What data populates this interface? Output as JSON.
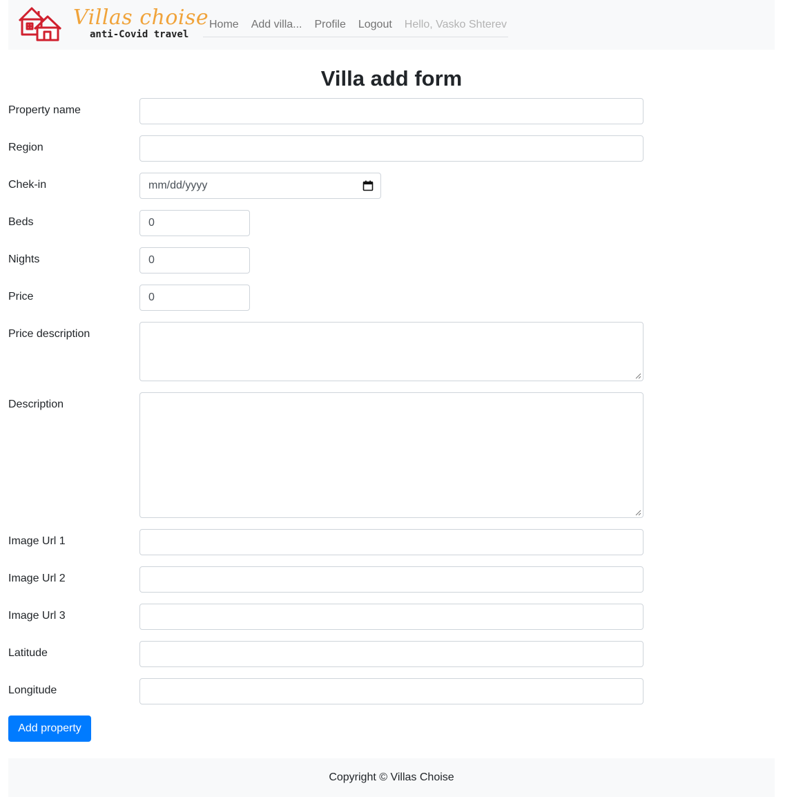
{
  "brand": {
    "name": "Villas choise",
    "tagline": "anti-Covid travel",
    "logo_icon": "houses-icon",
    "colors": {
      "script": "#f0a33a",
      "houses": "#d0202e"
    }
  },
  "nav": {
    "items": [
      {
        "label": "Home"
      },
      {
        "label": "Add villa..."
      },
      {
        "label": "Profile"
      },
      {
        "label": "Logout"
      }
    ],
    "greeting": "Hello, Vasko Shterev"
  },
  "form": {
    "title": "Villa add form",
    "fields": {
      "property_name": {
        "label": "Property name",
        "value": ""
      },
      "region": {
        "label": "Region",
        "value": ""
      },
      "checkin": {
        "label": "Chek-in",
        "placeholder": "mm/dd/yyyy",
        "icon": "calendar-icon"
      },
      "beds": {
        "label": "Beds",
        "value": "0"
      },
      "nights": {
        "label": "Nights",
        "value": "0"
      },
      "price": {
        "label": "Price",
        "value": "0"
      },
      "price_description": {
        "label": "Price description",
        "value": ""
      },
      "description": {
        "label": "Description",
        "value": ""
      },
      "image_url_1": {
        "label": "Image Url 1",
        "value": ""
      },
      "image_url_2": {
        "label": "Image Url 2",
        "value": ""
      },
      "image_url_3": {
        "label": "Image Url 3",
        "value": ""
      },
      "latitude": {
        "label": "Latitude",
        "value": ""
      },
      "longitude": {
        "label": "Longitude",
        "value": ""
      }
    },
    "submit_label": "Add property"
  },
  "footer": {
    "text": "Copyright © Villas Choise"
  },
  "colors": {
    "primary": "#007bff",
    "navbar_bg": "#f8f9fa",
    "nav_link": "#737373",
    "nav_greeting": "#b3b3b3"
  }
}
